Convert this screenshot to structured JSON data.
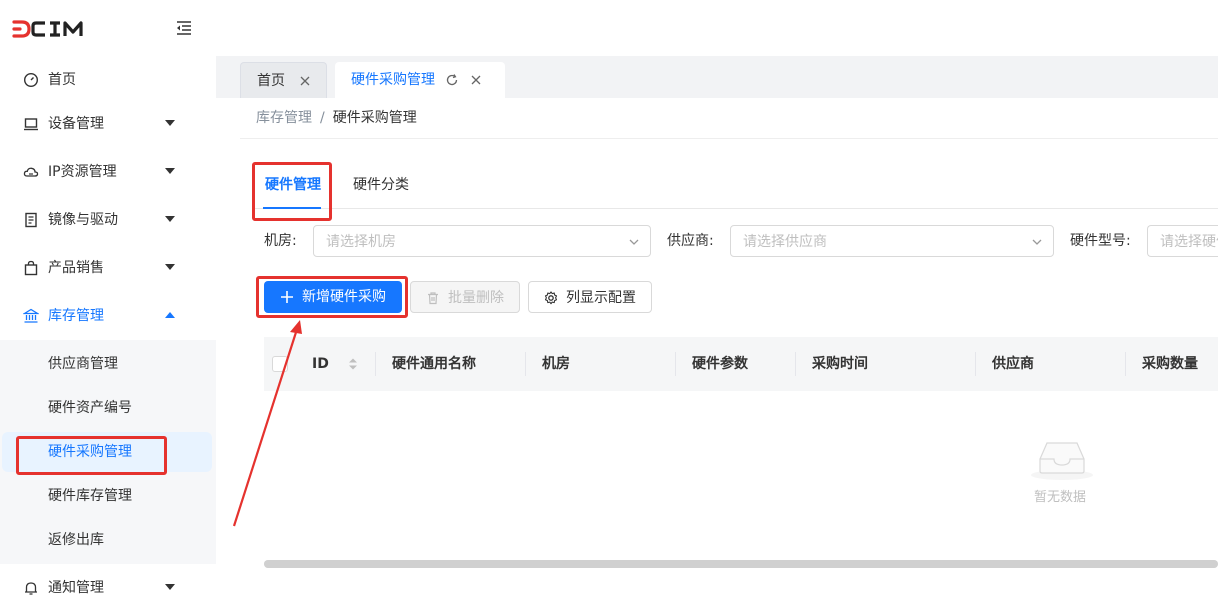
{
  "app": {
    "logo_text": "DCIM"
  },
  "sidebar": {
    "items": [
      {
        "label": "首页",
        "icon": "dashboard-icon"
      },
      {
        "label": "设备管理",
        "icon": "laptop-icon"
      },
      {
        "label": "IP资源管理",
        "icon": "cloud-icon"
      },
      {
        "label": "镜像与驱动",
        "icon": "file-icon"
      },
      {
        "label": "产品销售",
        "icon": "shopping-bag-icon"
      },
      {
        "label": "库存管理",
        "icon": "bank-icon"
      },
      {
        "label": "通知管理",
        "icon": "bell-icon"
      }
    ],
    "inventory_children": [
      {
        "label": "供应商管理"
      },
      {
        "label": "硬件资产编号"
      },
      {
        "label": "硬件采购管理"
      },
      {
        "label": "硬件库存管理"
      },
      {
        "label": "返修出库"
      }
    ]
  },
  "tabs": [
    {
      "label": "首页"
    },
    {
      "label": "硬件采购管理"
    }
  ],
  "breadcrumb": {
    "parent": "库存管理",
    "separator": "/",
    "current": "硬件采购管理"
  },
  "subtabs": [
    {
      "label": "硬件管理"
    },
    {
      "label": "硬件分类"
    }
  ],
  "filters": [
    {
      "label": "机房:",
      "placeholder": "请选择机房"
    },
    {
      "label": "供应商:",
      "placeholder": "请选择供应商"
    },
    {
      "label": "硬件型号:",
      "placeholder": "请选择硬件型号"
    }
  ],
  "toolbar": {
    "add_label": "新增硬件采购",
    "batch_delete_label": "批量删除",
    "column_config_label": "列显示配置"
  },
  "table": {
    "columns": [
      "ID",
      "硬件通用名称",
      "机房",
      "硬件参数",
      "采购时间",
      "供应商",
      "采购数量"
    ],
    "rows": [],
    "empty_text": "暂无数据"
  },
  "colors": {
    "accent": "#1677ff",
    "annotation": "#e5322e",
    "selected_bg": "#e8f3ff"
  }
}
